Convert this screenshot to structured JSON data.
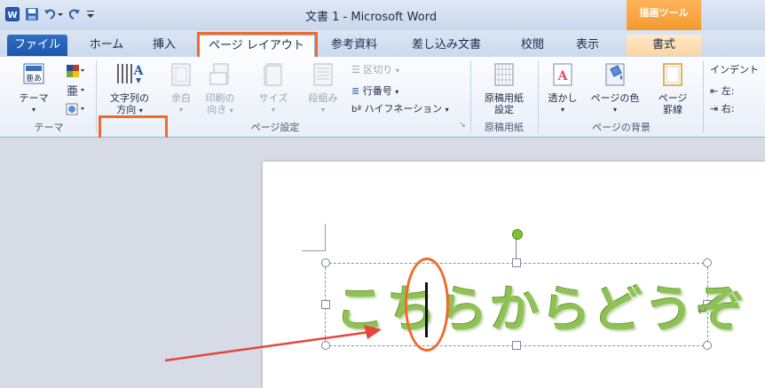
{
  "window": {
    "title": "文書 1 - Microsoft Word",
    "context_tool": "描画ツール"
  },
  "tabs": [
    "ファイル",
    "ホーム",
    "挿入",
    "ページ レイアウト",
    "参考資料",
    "差し込み文書",
    "校閲",
    "表示",
    "書式"
  ],
  "ribbon": {
    "theme": {
      "theme_btn": "テーマ",
      "group": "テーマ"
    },
    "page_setup": {
      "text_direction_1": "文字列の",
      "text_direction_2": "方向",
      "margins": "余白",
      "orientation_1": "印刷の",
      "orientation_2": "向き",
      "size": "サイズ",
      "columns": "段組み",
      "breaks": "区切り",
      "line_numbers": "行番号",
      "hyphenation": "ハイフネーション",
      "group": "ページ設定"
    },
    "manuscript": {
      "btn_1": "原稿用紙",
      "btn_2": "設定",
      "group": "原稿用紙"
    },
    "page_background": {
      "watermark": "透かし",
      "page_color": "ページの色",
      "page_borders_1": "ページ",
      "page_borders_2": "罫線",
      "group": "ページの背景"
    },
    "indent": {
      "label": "インデント",
      "left": "左:",
      "right": "右:"
    }
  },
  "document": {
    "textbox_text": "こちらからどうぞ"
  },
  "colors": {
    "highlight": "#ee6c2a",
    "arrow": "#e8453c",
    "text_green": "#8ec255",
    "file_tab": "#2f6fc5"
  }
}
